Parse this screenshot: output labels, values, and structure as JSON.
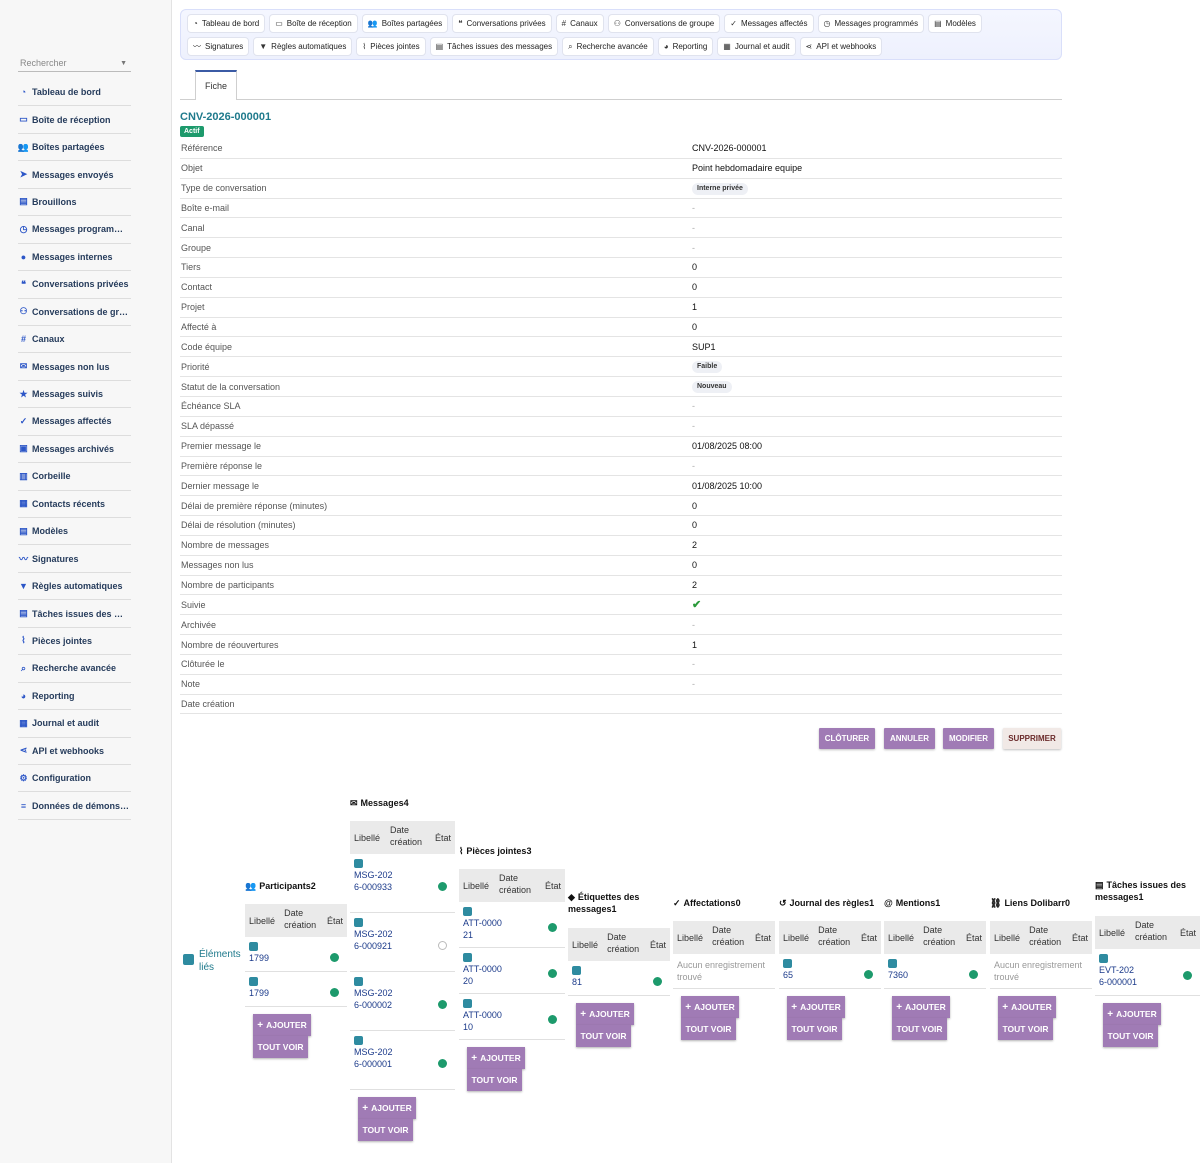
{
  "sidebar": {
    "search_placeholder": "Rechercher",
    "items": [
      {
        "label": "Tableau de bord",
        "icon": "dashboard-icon"
      },
      {
        "label": "Boîte de réception",
        "icon": "inbox-icon"
      },
      {
        "label": "Boîtes partagées",
        "icon": "users-icon"
      },
      {
        "label": "Messages envoyés",
        "icon": "paper-plane-icon"
      },
      {
        "label": "Brouillons",
        "icon": "file-icon"
      },
      {
        "label": "Messages programm…",
        "icon": "clock-icon"
      },
      {
        "label": "Messages internes",
        "icon": "chat-icon"
      },
      {
        "label": "Conversations privées",
        "icon": "comments-icon"
      },
      {
        "label": "Conversations de gr…",
        "icon": "group-icon"
      },
      {
        "label": "Canaux",
        "icon": "hashtag-icon"
      },
      {
        "label": "Messages non lus",
        "icon": "envelope-icon"
      },
      {
        "label": "Messages suivis",
        "icon": "star-icon"
      },
      {
        "label": "Messages affectés",
        "icon": "user-check-icon"
      },
      {
        "label": "Messages archivés",
        "icon": "archive-icon"
      },
      {
        "label": "Corbeille",
        "icon": "trash-icon"
      },
      {
        "label": "Contacts récents",
        "icon": "address-book-icon"
      },
      {
        "label": "Modèles",
        "icon": "file-icon"
      },
      {
        "label": "Signatures",
        "icon": "signature-icon"
      },
      {
        "label": "Règles automatiques",
        "icon": "filter-icon"
      },
      {
        "label": "Tâches issues des …",
        "icon": "tasks-icon"
      },
      {
        "label": "Pièces jointes",
        "icon": "paperclip-icon"
      },
      {
        "label": "Recherche avancée",
        "icon": "search-icon"
      },
      {
        "label": "Reporting",
        "icon": "pie-chart-icon"
      },
      {
        "label": "Journal et audit",
        "icon": "calendar-icon"
      },
      {
        "label": "API et webhooks",
        "icon": "share-icon"
      },
      {
        "label": "Configuration",
        "icon": "gear-icon"
      },
      {
        "label": "Données de démons…",
        "icon": "database-icon"
      }
    ]
  },
  "topnav": {
    "row1": [
      {
        "label": "Tableau de bord",
        "icon": "dashboard-icon"
      },
      {
        "label": "Boîte de réception",
        "icon": "inbox-icon"
      },
      {
        "label": "Boîtes partagées",
        "icon": "users-icon"
      },
      {
        "label": "Conversations privées",
        "icon": "comments-icon"
      },
      {
        "label": "Canaux",
        "icon": "hashtag-icon"
      },
      {
        "label": "Conversations de groupe",
        "icon": "group-icon"
      },
      {
        "label": "Messages affectés",
        "icon": "user-check-icon"
      },
      {
        "label": "Messages programmés",
        "icon": "clock-icon"
      },
      {
        "label": "Modèles",
        "icon": "file-icon"
      }
    ],
    "row2": [
      {
        "label": "Signatures",
        "icon": "signature-icon"
      },
      {
        "label": "Règles automatiques",
        "icon": "filter-icon"
      },
      {
        "label": "Pièces jointes",
        "icon": "paperclip-icon"
      },
      {
        "label": "Tâches issues des messages",
        "icon": "tasks-icon"
      },
      {
        "label": "Recherche avancée",
        "icon": "search-icon"
      },
      {
        "label": "Reporting",
        "icon": "pie-chart-icon"
      },
      {
        "label": "Journal et audit",
        "icon": "calendar-icon"
      },
      {
        "label": "API et webhooks",
        "icon": "share-icon"
      }
    ]
  },
  "tabs": {
    "fiche": "Fiche"
  },
  "record": {
    "ref": "CNV-2026-000001",
    "status": "Actif",
    "fields": [
      {
        "label": "Référence",
        "value": "CNV-2026-000001",
        "type": "text"
      },
      {
        "label": "Objet",
        "value": "Point hebdomadaire equipe",
        "type": "text"
      },
      {
        "label": "Type de conversation",
        "value": "Interne privée",
        "type": "pill"
      },
      {
        "label": "Boîte e-mail",
        "value": "-",
        "type": "dash"
      },
      {
        "label": "Canal",
        "value": "-",
        "type": "dash"
      },
      {
        "label": "Groupe",
        "value": "-",
        "type": "dash"
      },
      {
        "label": "Tiers",
        "value": "0",
        "type": "text"
      },
      {
        "label": "Contact",
        "value": "0",
        "type": "text"
      },
      {
        "label": "Projet",
        "value": "1",
        "type": "text"
      },
      {
        "label": "Affecté à",
        "value": "0",
        "type": "text"
      },
      {
        "label": "Code équipe",
        "value": "SUP1",
        "type": "text"
      },
      {
        "label": "Priorité",
        "value": "Faible",
        "type": "pill"
      },
      {
        "label": "Statut de la conversation",
        "value": "Nouveau",
        "type": "pill"
      },
      {
        "label": "Échéance SLA",
        "value": "-",
        "type": "dash"
      },
      {
        "label": "SLA dépassé",
        "value": "-",
        "type": "dash"
      },
      {
        "label": "Premier message le",
        "value": "01/08/2025 08:00",
        "type": "text"
      },
      {
        "label": "Première réponse le",
        "value": "-",
        "type": "dash"
      },
      {
        "label": "Dernier message le",
        "value": "01/08/2025 10:00",
        "type": "text"
      },
      {
        "label": "Délai de première réponse (minutes)",
        "value": "0",
        "type": "text"
      },
      {
        "label": "Délai de résolution (minutes)",
        "value": "0",
        "type": "text"
      },
      {
        "label": "Nombre de messages",
        "value": "2",
        "type": "text"
      },
      {
        "label": "Messages non lus",
        "value": "0",
        "type": "text"
      },
      {
        "label": "Nombre de participants",
        "value": "2",
        "type": "text"
      },
      {
        "label": "Suivie",
        "value": "✔",
        "type": "check"
      },
      {
        "label": "Archivée",
        "value": "-",
        "type": "dash"
      },
      {
        "label": "Nombre de réouvertures",
        "value": "1",
        "type": "text"
      },
      {
        "label": "Clôturée le",
        "value": "-",
        "type": "dash"
      },
      {
        "label": "Note",
        "value": "-",
        "type": "dash"
      },
      {
        "label": "Date création",
        "value": "",
        "type": "text"
      }
    ]
  },
  "actions": {
    "close": "CLÔTURER",
    "cancel": "ANNULER",
    "edit": "MODIFIER",
    "delete": "SUPPRIMER"
  },
  "linked": {
    "title": "Éléments liés",
    "col_label": "Libellé",
    "col_date": "Date création",
    "col_state": "État",
    "add_label": "AJOUTER",
    "see_all_label": "TOUT VOIR",
    "empty_text": "Aucun enregistrement trouvé",
    "blocks": [
      {
        "title": "Participants",
        "count": "2",
        "icon": "users-icon",
        "rows": [
          {
            "label": "1799",
            "state": "on"
          },
          {
            "label": "1799",
            "state": "on"
          }
        ]
      },
      {
        "title": "Messages",
        "count": "4",
        "icon": "envelope-icon",
        "rows": [
          {
            "label": "MSG-2026-000933",
            "state": "on"
          },
          {
            "label": "MSG-2026-000921",
            "state": "off"
          },
          {
            "label": "MSG-2026-000002",
            "state": "on"
          },
          {
            "label": "MSG-2026-000001",
            "state": "on"
          }
        ]
      },
      {
        "title": "Pièces jointes",
        "count": "3",
        "icon": "paperclip-icon",
        "rows": [
          {
            "label": "ATT-000021",
            "state": "on"
          },
          {
            "label": "ATT-000020",
            "state": "on"
          },
          {
            "label": "ATT-000010",
            "state": "on"
          }
        ]
      },
      {
        "title": "Étiquettes des messages",
        "count": "1",
        "icon": "tag-icon",
        "rows": [
          {
            "label": "81",
            "state": "on"
          }
        ]
      },
      {
        "title": "Affectations",
        "count": "0",
        "icon": "user-check-icon",
        "rows": []
      },
      {
        "title": "Journal des règles",
        "count": "1",
        "icon": "history-icon",
        "rows": [
          {
            "label": "65",
            "state": "on"
          }
        ]
      },
      {
        "title": "Mentions",
        "count": "1",
        "icon": "at-icon",
        "rows": [
          {
            "label": "7360",
            "state": "on"
          }
        ]
      },
      {
        "title": "Liens Dolibarr",
        "count": "0",
        "icon": "link-icon",
        "rows": []
      },
      {
        "title": "Tâches issues des messages",
        "count": "1",
        "icon": "tasks-icon",
        "rows": [
          {
            "label": "EVT-2026-000001",
            "state": "on"
          }
        ]
      }
    ]
  },
  "colors": {
    "accent": "#a07bb5",
    "teal": "#1f7a8c",
    "status_green": "#1d9a6c",
    "link": "#1b3a8a"
  }
}
